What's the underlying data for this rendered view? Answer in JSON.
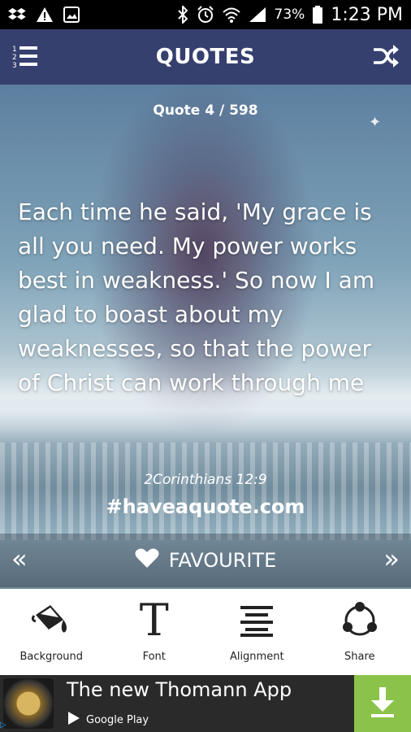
{
  "status_bar": {
    "battery": "73%",
    "time": "1:23 PM"
  },
  "app_bar": {
    "title": "QUOTES",
    "left_icon": "numbered-list-icon",
    "right_icon": "shuffle-icon"
  },
  "quote": {
    "counter": "Quote 4 / 598",
    "text": "Each time he said, 'My grace is all you need. My power works best in weakness.' So now I am glad to boast about my weaknesses, so that the power of Christ can work through me",
    "reference": "2Corinthians 12:9",
    "hashtag": "#haveaquote.com"
  },
  "favourite_bar": {
    "prev_label": "«",
    "label": "FAVOURITE",
    "next_label": "»"
  },
  "toolbar": {
    "items": [
      {
        "label": "Background",
        "icon": "paint-bucket-icon"
      },
      {
        "label": "Font",
        "icon": "font-icon"
      },
      {
        "label": "Alignment",
        "icon": "align-icon"
      },
      {
        "label": "Share",
        "icon": "share-icon"
      }
    ]
  },
  "ad": {
    "title": "The new Thomann App",
    "store": "Google Play",
    "download_color": "#8bc34a"
  },
  "colors": {
    "app_bar": "#36406f",
    "toolbar_bg": "#ffffff",
    "ad_bg": "#2a2a2a"
  }
}
